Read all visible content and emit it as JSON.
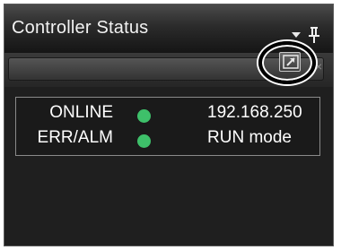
{
  "panel": {
    "title": "Controller Status",
    "close_glyph": "×"
  },
  "status": {
    "rows": [
      {
        "label": "ONLINE",
        "indicator_color": "#3ec06a",
        "value": "192.168.250"
      },
      {
        "label": "ERR/ALM",
        "indicator_color": "#3ec06a",
        "value": "RUN mode"
      }
    ]
  },
  "icons": {
    "dropdown": "chevron-down-icon",
    "pin": "pin-icon",
    "popout": "popout-icon"
  },
  "colors": {
    "status_ok": "#3ec06a",
    "panel_bg": "#1f1f1f",
    "text": "#ffffff"
  }
}
